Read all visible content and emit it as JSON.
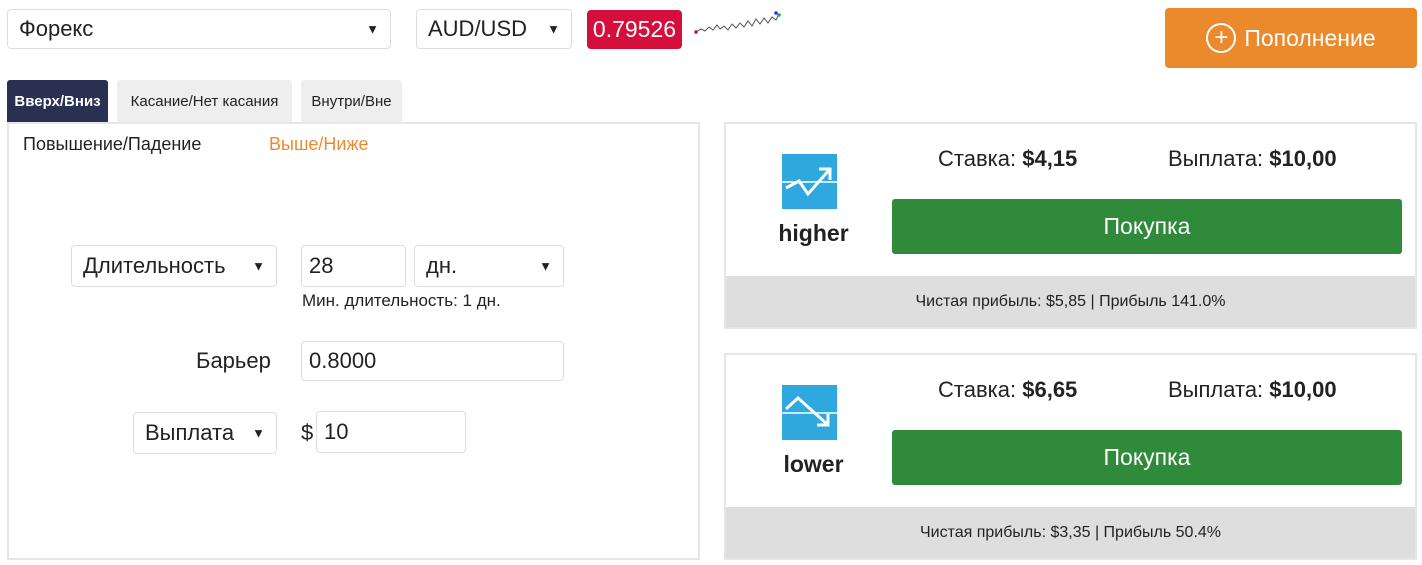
{
  "topbar": {
    "market": "Форекс",
    "symbol": "AUD/USD",
    "price": "0.79526",
    "deposit_label": "Пополнение"
  },
  "tabs": [
    {
      "label": "Вверх/Вниз",
      "active": true
    },
    {
      "label": "Касание/Нет касания",
      "active": false
    },
    {
      "label": "Внутри/Вне",
      "active": false
    }
  ],
  "subtabs": [
    {
      "label": "Повышение/Падение",
      "active": true
    },
    {
      "label": "Выше/Ниже",
      "active": false
    }
  ],
  "form": {
    "duration_type": "Длительность",
    "duration_value": "28",
    "duration_unit": "дн.",
    "min_duration": "Мин. длительность: 1 дн.",
    "barrier_label": "Барьер",
    "barrier_value": "0.8000",
    "amount_type": "Выплата",
    "currency_symbol": "$",
    "amount_value": "10"
  },
  "contracts": [
    {
      "name": "higher",
      "stake_label": "Ставка:",
      "stake": "$4,15",
      "payout_label": "Выплата:",
      "payout": "$10,00",
      "buy_label": "Покупка",
      "profit_text": "Чистая прибыль: $5,85 | Прибыль 141.0%",
      "icon": "trend-up-icon"
    },
    {
      "name": "lower",
      "stake_label": "Ставка:",
      "stake": "$6,65",
      "payout_label": "Выплата:",
      "payout": "$10,00",
      "buy_label": "Покупка",
      "profit_text": "Чистая прибыль: $3,35 | Прибыль 50.4%",
      "icon": "trend-down-icon"
    }
  ],
  "colors": {
    "accent_orange": "#eb8a2c",
    "price_red": "#d40f3c",
    "buy_green": "#2f8a3a",
    "tab_active": "#2a3052",
    "icon_blue": "#2ea8df"
  }
}
